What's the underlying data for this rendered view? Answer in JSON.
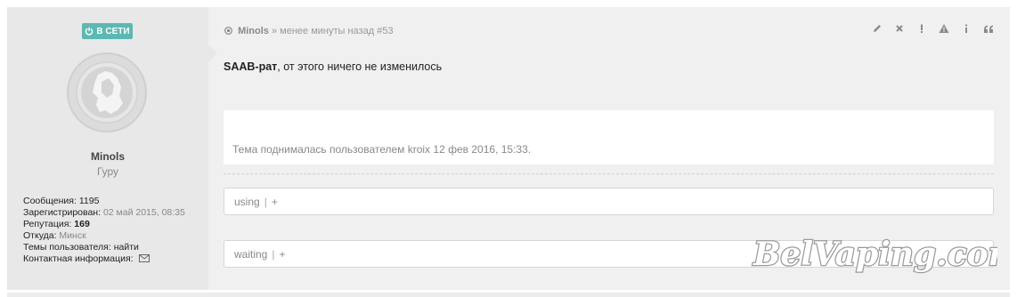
{
  "user": {
    "status_badge": "В СЕТИ",
    "avatar_icon": "forum-logo-avatar",
    "name": "Minols",
    "title": "Гуру",
    "info": {
      "messages_label": "Сообщения:",
      "messages_value": "1195",
      "registered_label": "Зарегистрирован:",
      "registered_value": "02 май 2015, 08:35",
      "reputation_label": "Репутация:",
      "reputation_value": "169",
      "from_label": "Откуда:",
      "from_value": "Минск",
      "topics_label": "Темы пользователя:",
      "topics_link": "найти",
      "contact_label": "Контактная информация:",
      "contact_icon": "mail-icon"
    }
  },
  "post": {
    "author": "Minols",
    "meta_separator": "»",
    "time": "менее минуты назад",
    "number": "#53",
    "mention": "SAAB-рат",
    "text": ", от этого ничего не изменилось",
    "bump_notice": "Тема поднималась пользователем kroix 12 фев 2016, 15:33.",
    "actions": [
      "edit-icon",
      "delete-icon",
      "report-icon",
      "warning-icon",
      "info-icon",
      "quote-icon"
    ]
  },
  "tags": {
    "using_label": "using",
    "waiting_label": "waiting",
    "separator": "|",
    "plus": "+"
  },
  "watermark": {
    "text": "BelVaping.com"
  },
  "colors": {
    "badge_bg": "#5cb8b2",
    "post_bg": "#f0f0f0",
    "user_col_bg": "#e8e8e8"
  }
}
